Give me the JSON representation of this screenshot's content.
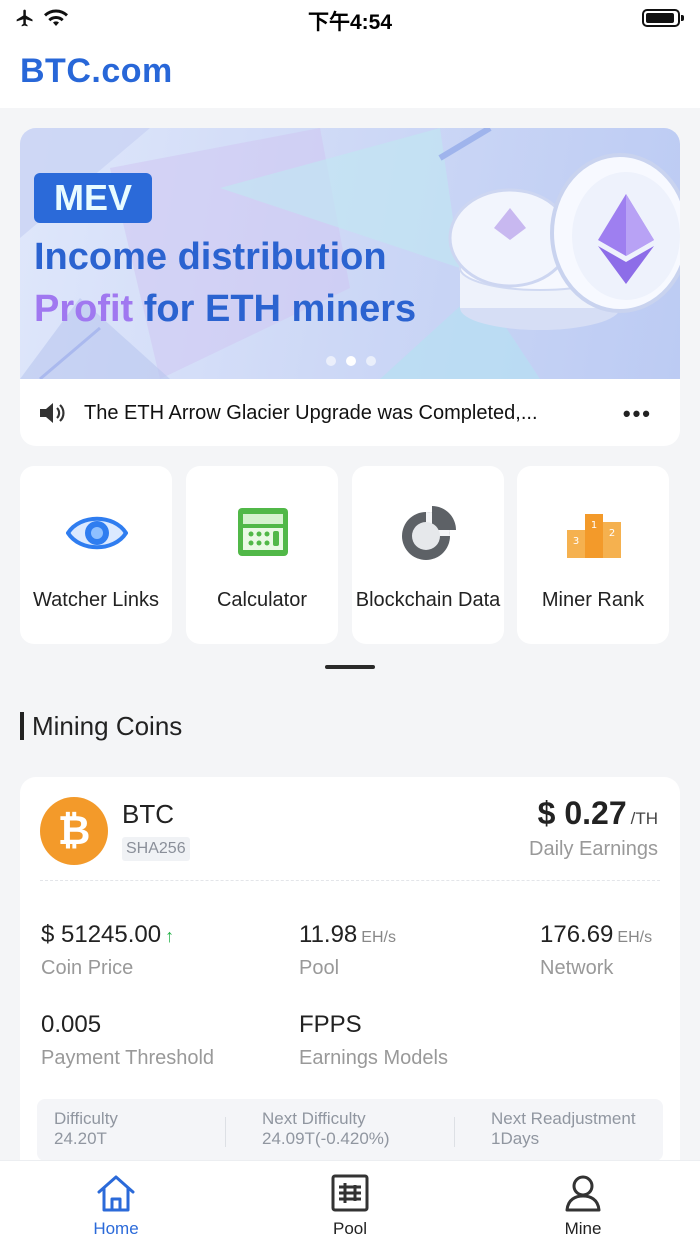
{
  "status_bar": {
    "time": "下午4:54"
  },
  "header": {
    "logo": "BTC.com"
  },
  "banner": {
    "badge": "MEV",
    "line1": "Income distribution",
    "line2_highlight": "Profit",
    "line2_rest": " for ETH miners",
    "dots": 3,
    "active_dot": 2
  },
  "notice": {
    "text": "The ETH  Arrow Glacier Upgrade was Completed,...",
    "more": "•••"
  },
  "tools": [
    {
      "label": "Watcher Links",
      "icon": "eye-icon"
    },
    {
      "label": "Calculator",
      "icon": "calculator-icon"
    },
    {
      "label": "Blockchain Data",
      "icon": "pie-chart-icon"
    },
    {
      "label": "Miner Rank",
      "icon": "podium-icon"
    }
  ],
  "section": {
    "title": "Mining Coins"
  },
  "coin": {
    "name": "BTC",
    "algo": "SHA256",
    "logo_glyph": "₿",
    "daily_earnings_value": "$ 0.27",
    "daily_earnings_unit": "/TH",
    "daily_earnings_label": "Daily Earnings",
    "price_value": "$ 51245.00",
    "price_trend": "↑",
    "price_label": "Coin Price",
    "pool_value": "11.98",
    "pool_unit": "EH/s",
    "pool_label": "Pool",
    "network_value": "176.69",
    "network_unit": "EH/s",
    "network_label": "Network",
    "threshold_value": "0.005",
    "threshold_label": "Payment Threshold",
    "model_value": "FPPS",
    "model_label": "Earnings Models",
    "difficulty_label": "Difficulty",
    "difficulty_value": "24.20T",
    "next_difficulty_label": "Next Difficulty",
    "next_difficulty_value": "24.09T(-0.420%)",
    "next_readjust_label": "Next Readjustment",
    "next_readjust_value": "1Days"
  },
  "tabbar": {
    "home": "Home",
    "pool": "Pool",
    "mine": "Mine"
  },
  "colors": {
    "accent": "#2b6ad9",
    "btc": "#f39a2a",
    "up": "#26b24a"
  }
}
